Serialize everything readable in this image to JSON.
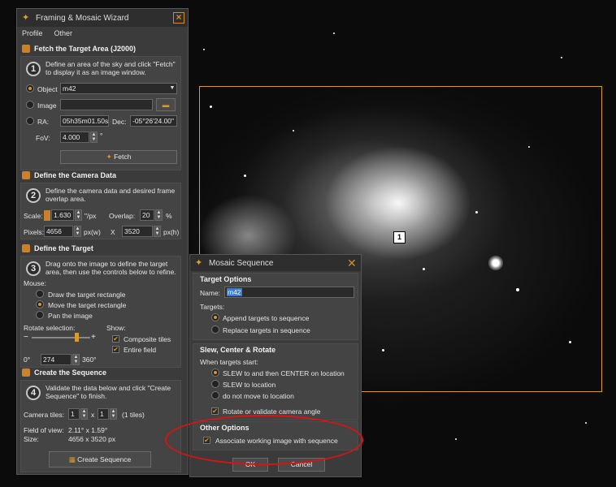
{
  "wizard": {
    "title": "Framing & Mosaic Wizard",
    "menu": [
      "Profile",
      "Other"
    ],
    "sections": {
      "fetch": {
        "header": "Fetch the Target Area (J2000)",
        "step": "1",
        "description_line1": "Define an area of the sky and click \"Fetch\"",
        "description_line2": "to display it as an image window.",
        "object_label": "Object",
        "object_value": "m42",
        "image_label": "Image",
        "ra_label": "RA:",
        "ra_value": "05h35m01.50s",
        "dec_label": "Dec:",
        "dec_value": "-05°26'24.00\"",
        "fov_label": "FoV:",
        "fov_value": "4.000",
        "fov_unit": "°",
        "fetch_button": "Fetch"
      },
      "camera": {
        "header": "Define the Camera Data",
        "step": "2",
        "description_line1": "Define the camera data and desired frame",
        "description_line2": "overlap area.",
        "scale_label": "Scale:",
        "scale_value": "1.630",
        "scale_unit": "\"/px",
        "overlap_label": "Overlap:",
        "overlap_value": "20",
        "overlap_unit": "%",
        "pixels_label": "Pixels:",
        "pixels_w": "4656",
        "pixels_w_unit": "px(w)",
        "x_label": "X",
        "pixels_h": "3520",
        "pixels_h_unit": "px(h)"
      },
      "target": {
        "header": "Define the Target",
        "step": "3",
        "description_line1": "Drag onto the image to define the target",
        "description_line2": "area, then use the controls below to refine.",
        "mouse_label": "Mouse:",
        "mouse_options": [
          "Draw the target rectangle",
          "Move the target rectangle",
          "Pan the image"
        ],
        "mouse_selected": 1,
        "rotate_label": "Rotate selection:",
        "rotate_min": "0°",
        "rotate_value": "274",
        "rotate_max": "360°",
        "slider_fraction": 0.76,
        "show_label": "Show:",
        "composite_tiles": "Composite tiles",
        "entire_field": "Entire field"
      },
      "sequence": {
        "header": "Create the Sequence",
        "step": "4",
        "description_line1": "Validate the data below and click \"Create",
        "description_line2": "Sequence\" to finish.",
        "tiles_label": "Camera tiles:",
        "tiles_x": "1",
        "tiles_sep": "x",
        "tiles_y": "1",
        "tiles_count": "(1 tiles)",
        "fov_label": "Field of view:",
        "fov_value": "2.11° x 1.59°",
        "size_label": "Size:",
        "size_value": "4656 x 3520 px",
        "create_button": "Create Sequence"
      }
    }
  },
  "frame": {
    "label": "1"
  },
  "mosaic": {
    "title": "Mosaic Sequence",
    "target_options": {
      "title": "Target Options",
      "name_label": "Name:",
      "name_value": "m42",
      "targets_label": "Targets:",
      "options": [
        "Append targets to sequence",
        "Replace targets in sequence"
      ],
      "selected": 0
    },
    "slew": {
      "title": "Slew, Center & Rotate",
      "when_label": "When targets start:",
      "options": [
        "SLEW to and then CENTER on location",
        "SLEW to location",
        "do not move to location"
      ],
      "selected": 0,
      "rotate_check": "Rotate or validate camera angle"
    },
    "other": {
      "title": "Other Options",
      "associate_check": "Associate working image with sequence"
    },
    "ok_button": "OK",
    "cancel_button": "Cancel"
  },
  "colors": {
    "accent": "#d89a2a",
    "annotation": "#dd1111",
    "panel": "#444444"
  }
}
